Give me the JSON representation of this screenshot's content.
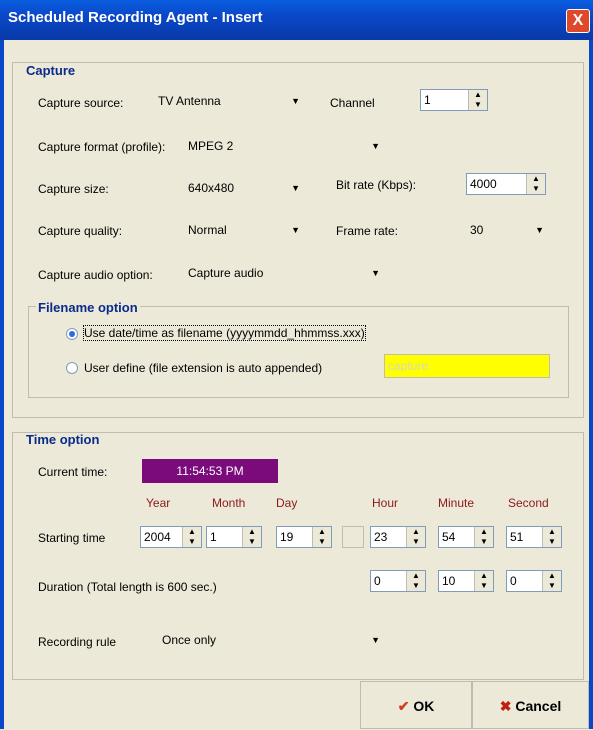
{
  "window": {
    "title": "Scheduled Recording Agent - Insert",
    "close": "X"
  },
  "capture": {
    "group_title": "Capture",
    "source_label": "Capture source:",
    "source_value": "TV Antenna",
    "channel_label": "Channel",
    "channel_value": "1",
    "format_label": "Capture format (profile):",
    "format_value": "MPEG 2",
    "size_label": "Capture size:",
    "size_value": "640x480",
    "bitrate_label": "Bit rate (Kbps):",
    "bitrate_value": "4000",
    "quality_label": "Capture quality:",
    "quality_value": "Normal",
    "framerate_label": "Frame rate:",
    "framerate_value": "30",
    "audio_label": "Capture audio option:",
    "audio_value": "Capture audio"
  },
  "filename": {
    "group_title": "Filename option",
    "option_datetime": "Use date/time as filename (yyyymmdd_hhmmss.xxx)",
    "option_user": "User define (file extension is auto appended)",
    "user_placeholder": "capture",
    "selected": "datetime"
  },
  "time": {
    "group_title": "Time option",
    "current_label": "Current time:",
    "current_value": "11:54:53 PM",
    "headers": {
      "year": "Year",
      "month": "Month",
      "day": "Day",
      "hour": "Hour",
      "minute": "Minute",
      "second": "Second"
    },
    "start_label": "Starting time",
    "start": {
      "year": "2004",
      "month": "1",
      "day": "19",
      "hour": "23",
      "minute": "54",
      "second": "51"
    },
    "duration_label": "Duration (Total length is 600 sec.)",
    "duration": {
      "hour": "0",
      "minute": "10",
      "second": "0"
    },
    "rule_label": "Recording rule",
    "rule_value": "Once only"
  },
  "buttons": {
    "ok": "OK",
    "cancel": "Cancel",
    "ok_icon": "✔",
    "cancel_icon": "✖"
  },
  "colors": {
    "titlebar": "#0a47c8",
    "current_time_bg": "#7b0a7b",
    "year_header": "#8b1a1a",
    "user_input_bg": "#ffff00"
  }
}
